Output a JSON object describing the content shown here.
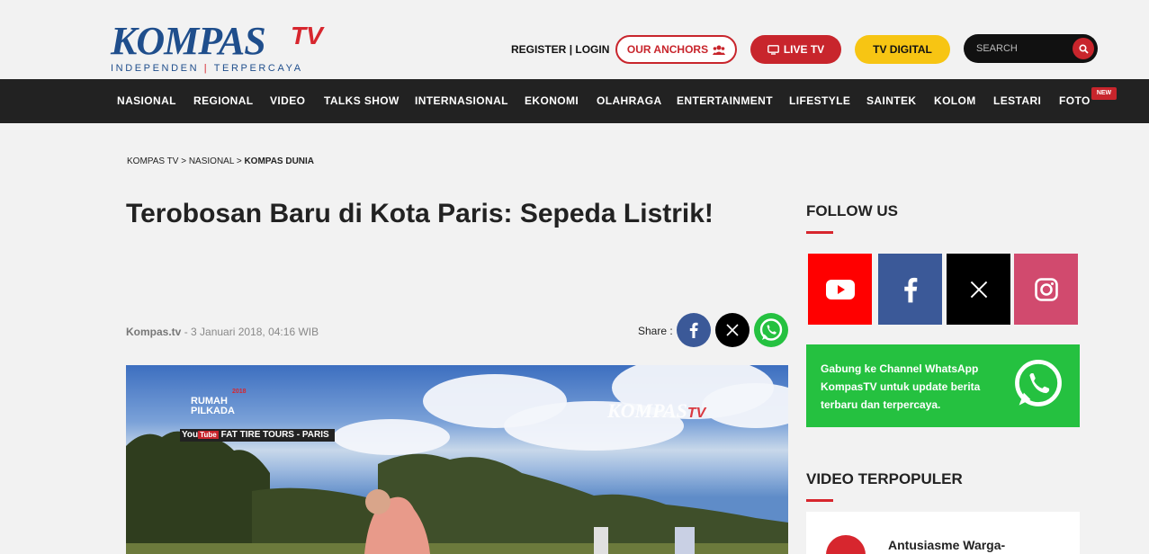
{
  "header": {
    "logo_main": "KOMPAS",
    "logo_tv": "TV",
    "tagline_left": "INDEPENDEN",
    "tagline_sep": "|",
    "tagline_right": "TERPERCAYA",
    "register": "REGISTER",
    "login_sep": "|",
    "login": "LOGIN",
    "anchors_label": "OUR ANCHORS",
    "live_label": "LIVE TV",
    "digital_label": "TV DIGITAL",
    "search_placeholder": "SEARCH"
  },
  "nav": {
    "items": [
      "NASIONAL",
      "REGIONAL",
      "VIDEO",
      "TALKS SHOW",
      "INTERNASIONAL",
      "EKONOMI",
      "OLAHRAGA",
      "ENTERTAINMENT",
      "LIFESTYLE",
      "SAINTEK",
      "KOLOM",
      "LESTARI",
      "FOTO"
    ],
    "new_badge": "NEW"
  },
  "breadcrumb": {
    "home": "KOMPAS TV",
    "sep": ">",
    "section": "NASIONAL",
    "current": "KOMPAS DUNIA"
  },
  "article": {
    "title": "Terobosan Baru di Kota Paris: Sepeda Listrik!",
    "source": "Kompas.tv",
    "date": " - 3 Januari 2018, 04:16 WIB",
    "share_label": "Share :"
  },
  "video": {
    "watermark_main": "KOMPAS",
    "watermark_tv": "TV",
    "badge_year": "2018",
    "badge_line1": "RUMAH",
    "badge_line2": "PILKADA",
    "yt_label": "You",
    "yt_tube": "Tube",
    "yt_caption": "FAT TIRE TOURS - PARIS"
  },
  "sidebar": {
    "follow_title": "FOLLOW US",
    "social": [
      {
        "name": "youtube",
        "color": "#ff0000"
      },
      {
        "name": "facebook",
        "color": "#3b5998"
      },
      {
        "name": "x",
        "color": "#000000"
      },
      {
        "name": "instagram",
        "color": "#d14a6e"
      }
    ],
    "wa_text": "Gabung ke Channel WhatsApp KompasTV untuk update berita terbaru dan terpercaya.",
    "popular_title": "VIDEO TERPOPULER",
    "popular_first": "Antusiasme Warga-"
  },
  "colors": {
    "brand_blue": "#1f4e8c",
    "brand_red": "#d7262e",
    "nav_bg": "#222222",
    "digital_yellow": "#f7c513",
    "whatsapp_green": "#25c140"
  }
}
